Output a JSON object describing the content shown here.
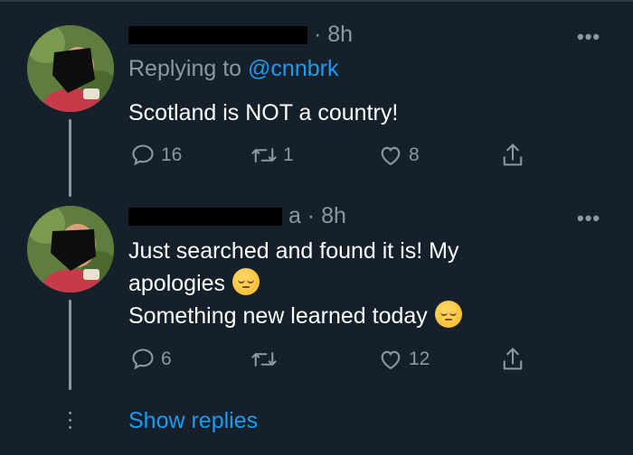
{
  "tweet1": {
    "time": "· 8h",
    "replying_prefix": "Replying to",
    "replying_mention": "@cnnbrk",
    "text": "Scotland is NOT a country!",
    "more_glyph": "•••",
    "reply_count": "16",
    "retweet_count": "1",
    "like_count": "8"
  },
  "tweet2": {
    "time": "a · 8h",
    "line1": "Just searched and found it is! My",
    "line2": "apologies",
    "line3": "Something new learned today",
    "more_glyph": "•••",
    "reply_count": "6",
    "retweet_count": "",
    "like_count": "12"
  },
  "show_replies": "Show replies",
  "icons": [
    "reply-icon",
    "retweet-icon",
    "like-icon",
    "share-icon",
    "more-icon",
    "pensive-emoji",
    "relieved-emoji"
  ],
  "colors": {
    "background": "#15202b",
    "text": "#ffffff",
    "secondary": "#8b98a5",
    "accent": "#1d9bf0"
  }
}
